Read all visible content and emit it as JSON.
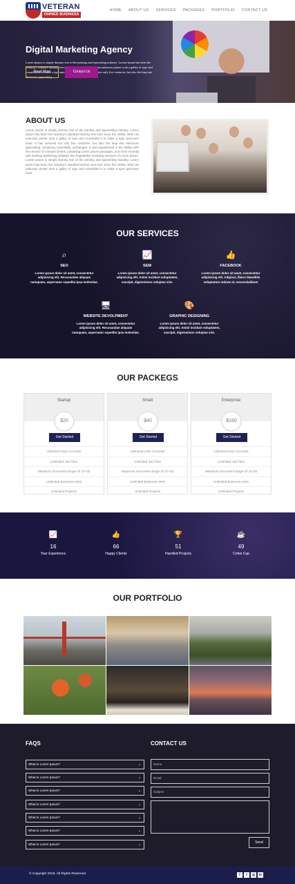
{
  "logo": {
    "line1": "VETERAN",
    "line2": "OWNED BUSINESS"
  },
  "nav": [
    "HOME",
    "ABOUT US",
    "SERVICES",
    "PACKAGES",
    "PORTFOLIO",
    "CONTACT US"
  ],
  "hero": {
    "title": "Digital Marketing Agency",
    "text": "Lorem Ipsum is simply dummy text of the printing and typesetting industry. Lorem Ipsum has been the industry's standard dummy text ever since the 1500s, when an unknown printer took a galley of type and scrambled it to make a type specimen book. It has survived not only five centuries, but also the leap into electronic typesetting...",
    "read_more": "Read More",
    "contact_us": "Contact Us"
  },
  "about": {
    "title": "ABOUT US",
    "text": "Lorem Ipsum is simply dummy text of the printing and typesetting industry. Lorem Ipsum has been the industry's standard dummy text ever since the 1500s, when an unknown printer took a galley of type and scrambled it to make a type specimen book. It has survived not only five centuries, but also the leap into electronic typesetting, remaining essentially unchanged. It was popularised in the 1960s with the release of Letraset sheets containing Lorem Ipsum passages, and more recently with desktop publishing software like PageMaker including versions of Lorem Ipsum. Lorem Ipsum is simply dummy text of the printing and typesetting industry. Lorem Ipsum has been the industry's standard dummy text ever since the 1500s, when an unknown printer took a galley of type and scrambled it to make a type specimen book."
  },
  "services": {
    "title": "OUR SERVICES",
    "items": [
      {
        "icon": "seo-magnifier-icon",
        "title": "SEO",
        "text": "Lorem ipsum dolor sit amet, consectetur adipisicing elit. Recusandae aliquam numquam, aspernatur expedita ipsa molestiae."
      },
      {
        "icon": "sem-chart-icon",
        "title": "SEM",
        "text": "Lorem ipsum dolor sit amet, consectetur adipisicing elit. Animi incidunt voluptatem, suscipit, dignissimos voluptas sint."
      },
      {
        "icon": "facebook-like-icon",
        "title": "FACEBOOK",
        "text": "Lorem ipsum dolor sit amet, consectetur adipisicing elit. Adipisci, libero blanditiis voluptatum ratione et, necessitatibus!"
      },
      {
        "icon": "monitor-gear-icon",
        "title": "WEBSITE DEVOLPMENT",
        "text": "Lorem ipsum dolor sit amet, consectetur adipisicing elit. Recusandae aliquam numquam, aspernatur expedita ipsa molestiae."
      },
      {
        "icon": "paint-palette-icon",
        "title": "GRAPHIC DESIGNING",
        "text": "Lorem ipsum dolor sit amet, consectetur adipisicing elit. Animi incidunt voluptatem, suscipit, dignissimos voluptas sint."
      }
    ]
  },
  "packages": {
    "title": "OUR PACKEGS",
    "items": [
      {
        "name": "Startup",
        "price": "$20",
        "button": "Get Started",
        "features": [
          "Unlimited User Accounts",
          "Unlimited Job Files",
          "Maximum Document Stoge Of 10 Gb",
          "Unlimited Business Units",
          "Unlimited Projects"
        ]
      },
      {
        "name": "Small",
        "price": "$40",
        "button": "Get Started",
        "features": [
          "Unlimited User Accounts",
          "Unlimited Job Files",
          "Maximum Document Stoge Of 10 Gb",
          "Unlimited Business Units",
          "Unlimited Projects"
        ]
      },
      {
        "name": "Enterprise",
        "price": "$160",
        "button": "Get Started",
        "features": [
          "Unlimited User Accounts",
          "Unlimited Job Files",
          "Maximum Document Stoge Of 10 Gb",
          "Unlimited Business Units",
          "Unlimited Projects"
        ]
      }
    ]
  },
  "stats": [
    {
      "icon": "line-chart-icon",
      "value": "16",
      "label": "Your Experience"
    },
    {
      "icon": "thumbs-up-icon",
      "value": "66",
      "label": "Happy Clients"
    },
    {
      "icon": "trophy-icon",
      "value": "51",
      "label": "Handled Projects"
    },
    {
      "icon": "coffee-cup-icon",
      "value": "49",
      "label": "Cofee Cup"
    }
  ],
  "portfolio": {
    "title": "OUR PORTFOLIO",
    "images": [
      "golden-gate-bridge-photo",
      "train-station-crowd-photo",
      "green-hills-road-photo",
      "orange-tulips-photo",
      "dusk-house-photo",
      "sunset-sea-photo"
    ]
  },
  "faqs": {
    "title": "FAQS",
    "items": [
      "What is Lorem Ipsum?",
      "What is Lorem Ipsum?",
      "What is Lorem Ipsum?",
      "What is Lorem Ipsum?",
      "What is Lorem Ipsum?",
      "What is Lorem Ipsum?",
      "What is Lorem Ipsum?"
    ]
  },
  "contact": {
    "title": "CONTACT US",
    "name_placeholder": "Name",
    "email_placeholder": "Email",
    "subject_placeholder": "Subject",
    "send": "Send"
  },
  "footer": {
    "copyright": "© Copyright 2018. All Rights Reserved.",
    "social": [
      {
        "icon": "facebook-icon",
        "glyph": "f"
      },
      {
        "icon": "twitter-icon",
        "glyph": "t"
      },
      {
        "icon": "instagram-icon",
        "glyph": "◎"
      },
      {
        "icon": "linkedin-icon",
        "glyph": "in"
      }
    ]
  },
  "colors": {
    "navy": "#1d2255",
    "accent_pink": "#9b1a8e",
    "gold_outline": "#e0b13a",
    "dark_bg": "#16142a"
  }
}
